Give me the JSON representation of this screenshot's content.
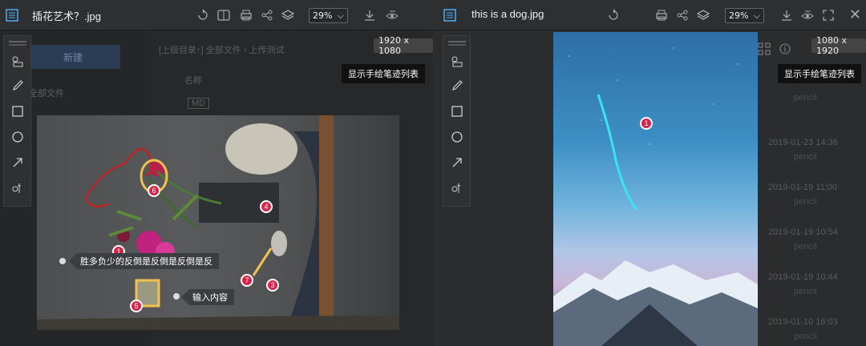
{
  "left": {
    "title": "插花艺术？.jpg",
    "zoom": "29%",
    "image_size": "1920 x 1080",
    "show_list_button": "显示手绘笔迹列表",
    "background": {
      "new_button": "新建",
      "all_files": "全部文件",
      "breadcrumb": "[上级目录↑] 全部文件 › 上传测试",
      "column_name": "名称",
      "file_type": "MD"
    },
    "annotations": [
      {
        "n": "6"
      },
      {
        "n": "4"
      },
      {
        "n": "1"
      },
      {
        "n": "7"
      },
      {
        "n": "3"
      },
      {
        "n": "5"
      }
    ],
    "callouts": [
      {
        "text": "胜多负少的反倒是反倒是反倒是反"
      },
      {
        "text": "输入内容"
      }
    ]
  },
  "right": {
    "title": "this is a dog.jpg",
    "zoom": "29%",
    "image_size": "1080 x 1920",
    "show_list_button": "显示手绘笔迹列表",
    "annotation": "1",
    "list": [
      {
        "date": "",
        "tag": "pencil"
      },
      {
        "date": "2019-01-23 14:36",
        "tag": "pencil"
      },
      {
        "date": "2019-01-19 11:00",
        "tag": "pencil"
      },
      {
        "date": "2019-01-19 10:54",
        "tag": "pencil"
      },
      {
        "date": "2019-01-19 10:44",
        "tag": "pencil"
      },
      {
        "date": "2019-01-10 16:03",
        "tag": "pencil"
      }
    ]
  },
  "colors": {
    "badge": "#d9234a",
    "freehand_red": "#d11a1a",
    "highlight_yellow": "#f2c14e",
    "freehand_cyan": "#39e3f2"
  }
}
